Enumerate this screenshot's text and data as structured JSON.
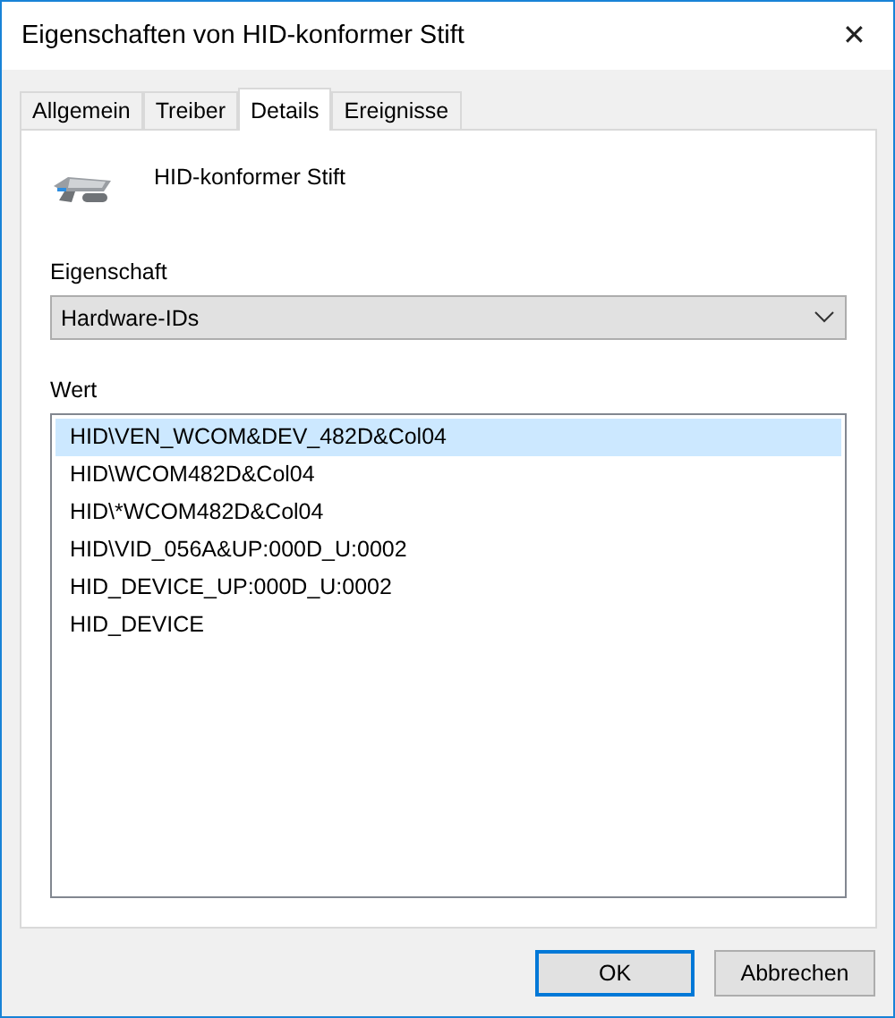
{
  "window": {
    "title": "Eigenschaften von HID-konformer Stift",
    "close": "✕"
  },
  "tabs": [
    {
      "label": "Allgemein",
      "selected": false
    },
    {
      "label": "Treiber",
      "selected": false
    },
    {
      "label": "Details",
      "selected": true
    },
    {
      "label": "Ereignisse",
      "selected": false
    }
  ],
  "device": {
    "name": "HID-konformer Stift"
  },
  "property": {
    "label": "Eigenschaft",
    "value": "Hardware-IDs"
  },
  "values": {
    "label": "Wert",
    "items": [
      {
        "text": "HID\\VEN_WCOM&DEV_482D&Col04",
        "selected": true
      },
      {
        "text": "HID\\WCOM482D&Col04",
        "selected": false
      },
      {
        "text": "HID\\*WCOM482D&Col04",
        "selected": false
      },
      {
        "text": "HID\\VID_056A&UP:000D_U:0002",
        "selected": false
      },
      {
        "text": "HID_DEVICE_UP:000D_U:0002",
        "selected": false
      },
      {
        "text": "HID_DEVICE",
        "selected": false
      }
    ]
  },
  "buttons": [
    {
      "label": "OK",
      "default": true
    },
    {
      "label": "Abbrechen",
      "default": false
    }
  ]
}
